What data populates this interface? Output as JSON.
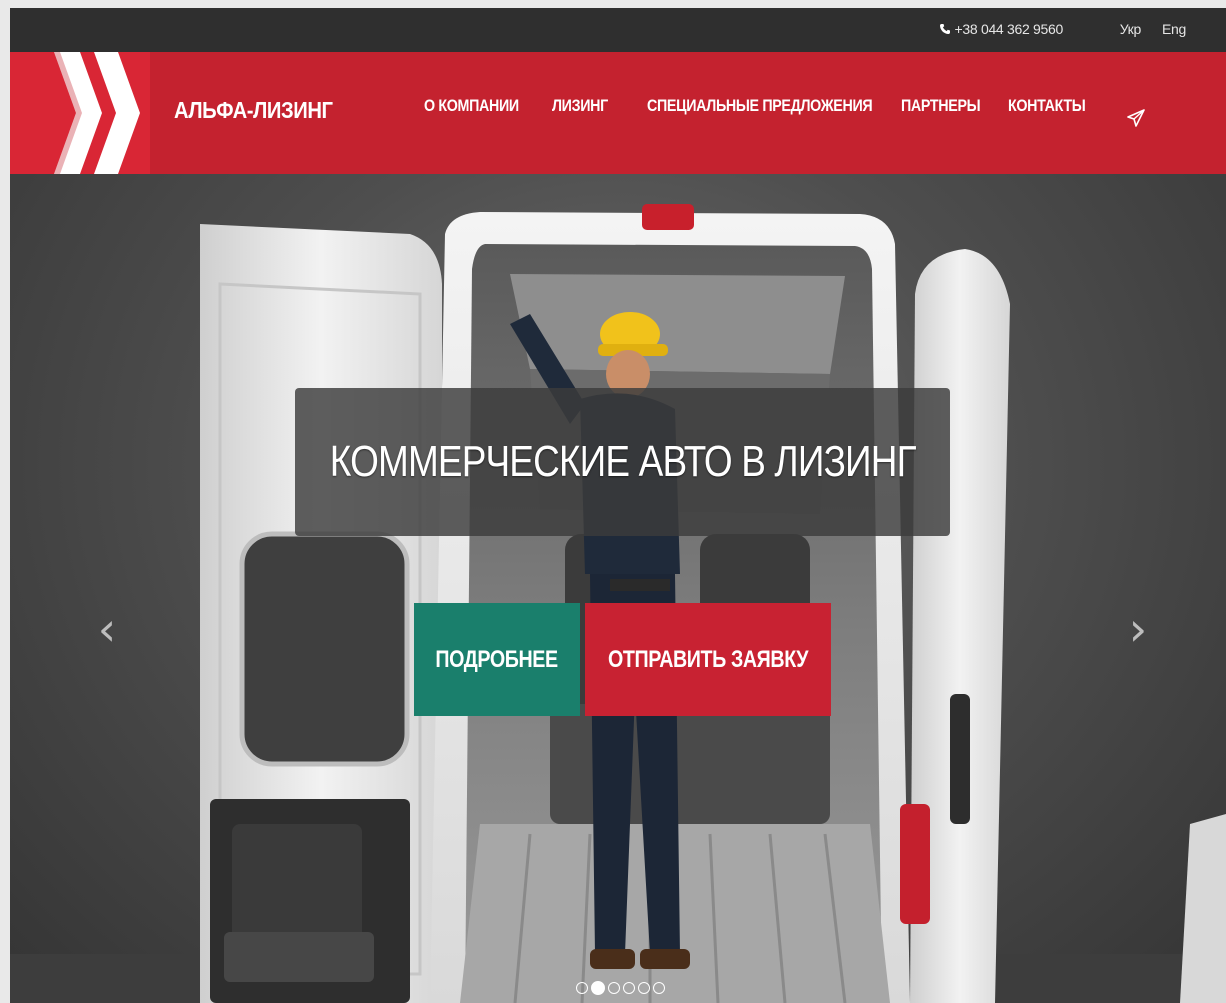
{
  "topbar": {
    "phone": "+38 044 362 9560",
    "lang_uk": "Укр",
    "lang_en": "Eng"
  },
  "header": {
    "brand": "АЛЬФА-ЛИЗИНГ",
    "nav": [
      {
        "label": "О КОМПАНИИ"
      },
      {
        "label": "ЛИЗИНГ"
      },
      {
        "label": "СПЕЦИАЛЬНЫЕ ПРЕДЛОЖЕНИЯ"
      },
      {
        "label": "ПАРТНЕРЫ"
      },
      {
        "label": "КОНТАКТЫ"
      }
    ],
    "send_icon": "paper-plane-icon"
  },
  "hero": {
    "title": "КОММЕРЧЕСКИЕ АВТО В ЛИЗИНГ",
    "more_button": "ПОДРОБНЕЕ",
    "request_button": "ОТПРАВИТЬ ЗАЯВКУ",
    "prev_arrow": "‹",
    "next_arrow": "›",
    "slides_total": 6,
    "active_slide": 2
  },
  "colors": {
    "brand_red": "#c4222f",
    "teal": "#1a7f6c",
    "topbar": "#2f2f2f"
  }
}
